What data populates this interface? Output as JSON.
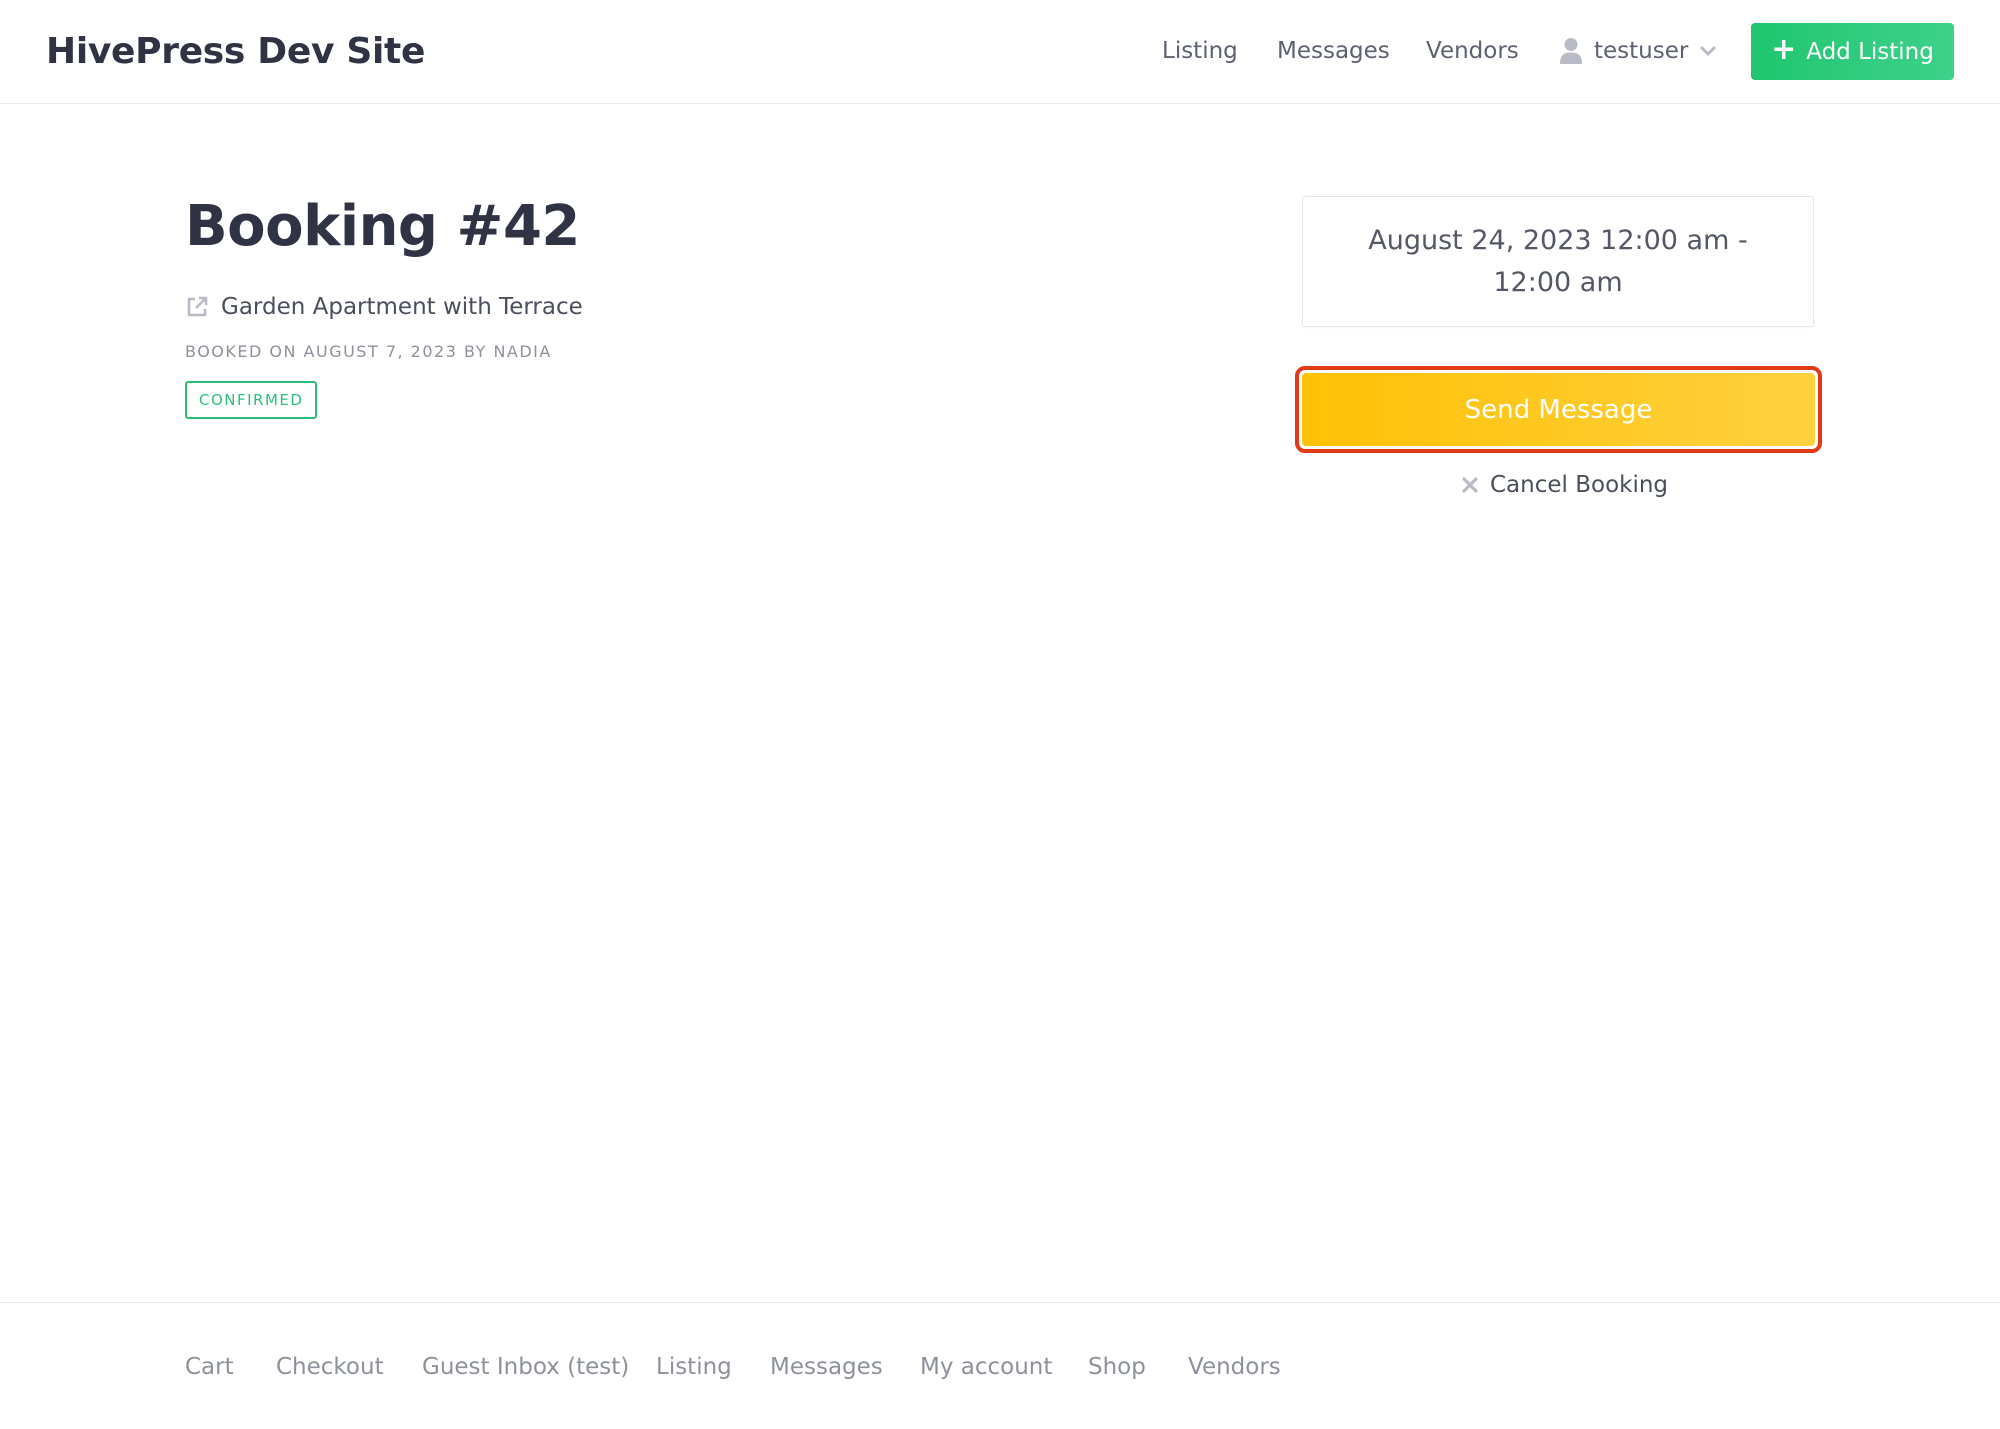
{
  "header": {
    "site_title": "HivePress Dev Site",
    "nav": {
      "listing": "Listing",
      "messages": "Messages",
      "vendors": "Vendors"
    },
    "user": {
      "name": "testuser",
      "icon": "user-icon"
    },
    "add_listing_label": "Add Listing"
  },
  "booking": {
    "title": "Booking #42",
    "listing_name": "Garden Apartment with Terrace",
    "booked_on": "BOOKED ON AUGUST 7, 2023 BY NADIA",
    "status": "CONFIRMED"
  },
  "sidebar": {
    "date_range": "August 24, 2023 12:00 am - 12:00 am",
    "send_message_label": "Send Message",
    "cancel_label": "Cancel Booking"
  },
  "footer": {
    "links": [
      "Cart",
      "Checkout",
      "Guest Inbox (test)",
      "Listing",
      "Messages",
      "My account",
      "Shop",
      "Vendors"
    ]
  },
  "colors": {
    "accent_green": "#1fc66f",
    "accent_yellow": "#ffc106",
    "highlight_red": "#e23a17",
    "status_green": "#2dbf78"
  }
}
